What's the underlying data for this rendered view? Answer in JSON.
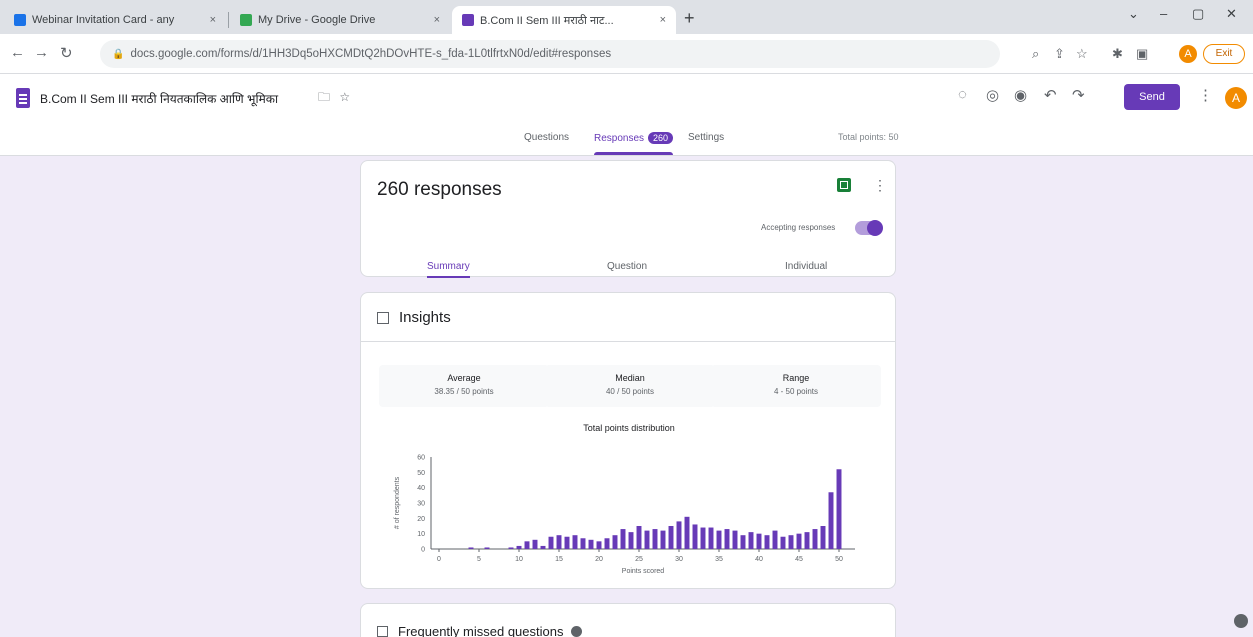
{
  "browser": {
    "tabs": [
      {
        "title": "Webinar Invitation Card - any",
        "active": false,
        "favicon_color": "#1a73e8"
      },
      {
        "title": "My Drive - Google Drive",
        "active": false,
        "favicon_color": "#34a853"
      },
      {
        "title": "B.Com II Sem III मराठी नाट...",
        "active": true,
        "favicon_color": "#673ab7"
      }
    ],
    "close_glyph": "×",
    "new_tab_glyph": "+",
    "url": "docs.google.com/forms/d/1HH3Dq5oHXCMDtQ2hDOvHTE-s_fda-1L0tlfrtxN0d/edit#responses"
  },
  "form": {
    "title": "B.Com II Sem III मराठी नियतकालिक आणि भूमिका",
    "send_label": "Send",
    "avatar_letter": "A",
    "tabs": {
      "questions": "Questions",
      "responses": "Responses",
      "responses_count": "260",
      "settings": "Settings"
    },
    "total_points": "Total points: 50"
  },
  "responses": {
    "count_label": "260 responses",
    "accepting_label": "Accepting responses",
    "subtabs": [
      "Summary",
      "Question",
      "Individual"
    ]
  },
  "insights": {
    "heading": "Insights",
    "stats": [
      {
        "label": "Average",
        "value": "38.35 / 50 points"
      },
      {
        "label": "Median",
        "value": "40 / 50 points"
      },
      {
        "label": "Range",
        "value": "4 - 50 points"
      }
    ],
    "chart_title": "Total points distribution"
  },
  "chart_data": {
    "type": "bar",
    "title": "Total points distribution",
    "xlabel": "Points scored",
    "ylabel": "# of respondents",
    "ylim": [
      0,
      60
    ],
    "yticks": [
      0,
      10,
      20,
      30,
      40,
      50,
      60
    ],
    "xticks": [
      0,
      5,
      10,
      15,
      20,
      25,
      30,
      35,
      40,
      45,
      50
    ],
    "x": [
      4,
      6,
      9,
      10,
      11,
      12,
      13,
      14,
      15,
      16,
      17,
      18,
      19,
      20,
      21,
      22,
      23,
      24,
      25,
      26,
      27,
      28,
      29,
      30,
      31,
      32,
      33,
      34,
      35,
      36,
      37,
      38,
      39,
      40,
      41,
      42,
      43,
      44,
      45,
      46,
      47,
      48,
      49,
      50
    ],
    "values": [
      1,
      1,
      1,
      2,
      5,
      6,
      2,
      8,
      9,
      8,
      9,
      7,
      6,
      5,
      7,
      9,
      13,
      11,
      15,
      12,
      13,
      12,
      15,
      18,
      21,
      16,
      14,
      14,
      12,
      13,
      12,
      9,
      11,
      10,
      9,
      12,
      8,
      9,
      10,
      11,
      13,
      15,
      37,
      52
    ],
    "bar_color": "#673ab7"
  },
  "frequently_missed": {
    "heading": "Frequently missed questions"
  }
}
